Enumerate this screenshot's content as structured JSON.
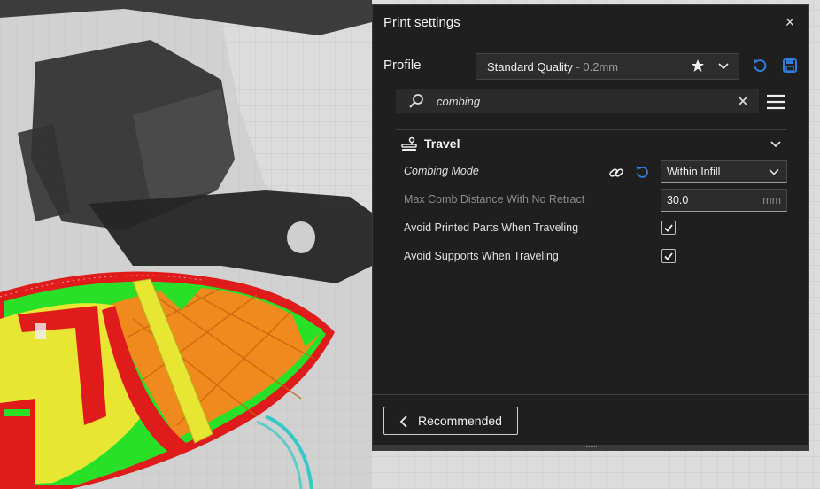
{
  "panel": {
    "title": "Print settings",
    "close_glyph": "×",
    "profile_label": "Profile",
    "profile_name": "Standard Quality",
    "profile_layer": " - 0.2mm",
    "search_value": "combing",
    "category": "Travel",
    "settings": [
      {
        "label": "Combing Mode",
        "value": "Within Infill"
      },
      {
        "label": "Max Comb Distance With No Retract",
        "value": "30.0",
        "unit": "mm"
      },
      {
        "label": "Avoid Printed Parts When Traveling",
        "checked": true
      },
      {
        "label": "Avoid Supports When Traveling",
        "checked": true
      }
    ],
    "recommended_label": "Recommended"
  },
  "icons": {
    "close": "close-icon",
    "favorite": "star-icon",
    "dropdown": "chevron-down-icon",
    "reset": "reset-icon",
    "save": "save-icon",
    "search": "search-icon",
    "clear": "clear-icon",
    "menu": "hamburger-menu-icon",
    "category": "travel-icon",
    "link": "link-icon",
    "revert": "revert-icon",
    "back": "chevron-left-icon"
  },
  "colors": {
    "panel_bg": "#1f1f1f",
    "accent_blue": "#2f7ddc",
    "viewport_bg": "#dcdcdc",
    "model_red": "#e01b1b",
    "model_green": "#28e028",
    "model_yellow": "#e6e633",
    "model_orange": "#f08a1c"
  }
}
